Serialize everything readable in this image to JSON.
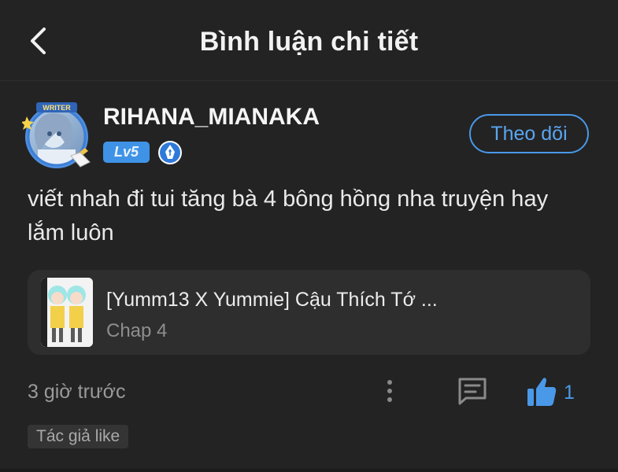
{
  "header": {
    "title": "Bình luận chi tiết",
    "back_icon": "chevron-left-icon"
  },
  "comment": {
    "avatar_badge": "WRITER",
    "username": "RIHANA_MIANAKA",
    "level": "Lv5",
    "follow_label": "Theo dõi",
    "text": "viết nhah đi tui tăng bà 4 bông hồng nha truyện hay lắm luôn",
    "time": "3 giờ trước",
    "like_count": "1",
    "author_like": "Tác giả like"
  },
  "story": {
    "title": "[Yumm13 X Yummie] Cậu Thích Tớ ...",
    "chapter": "Chap 4"
  },
  "colors": {
    "background": "#232323",
    "card": "#2e2e2e",
    "accent": "#4a98e8",
    "level_badge": "#3f93e6"
  }
}
